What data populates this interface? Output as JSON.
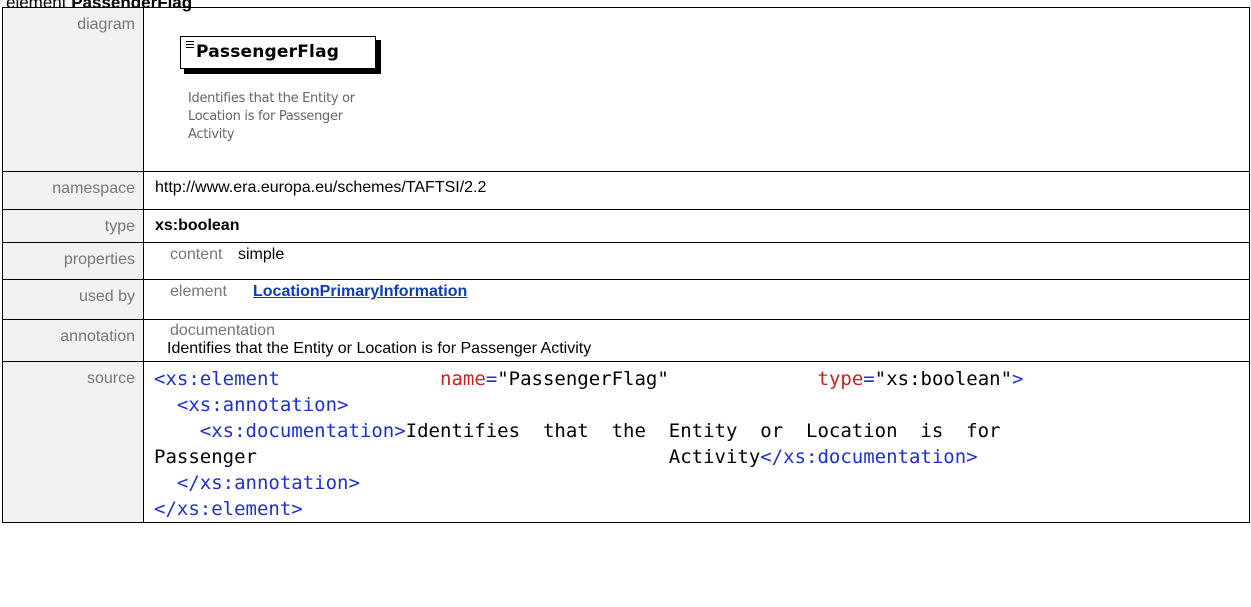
{
  "heading": {
    "prefix": "element ",
    "name": "PassengerFlag"
  },
  "rows": {
    "diagram": {
      "label": "diagram",
      "element_name": "PassengerFlag",
      "doc_lines": [
        "Identifies that the Entity or",
        "Location is for Passenger",
        "Activity"
      ]
    },
    "namespace": {
      "label": "namespace",
      "value": "http://www.era.europa.eu/schemes/TAFTSI/2.2"
    },
    "type": {
      "label": "type",
      "value": "xs:boolean"
    },
    "properties": {
      "label": "properties",
      "key": "content",
      "value": "simple"
    },
    "used_by": {
      "label": "used by",
      "key": "element",
      "link": "LocationPrimaryInformation"
    },
    "annotation": {
      "label": "annotation",
      "key": "documentation",
      "value": "Identifies that the Entity or Location is for Passenger Activity"
    },
    "source": {
      "label": "source",
      "line1_open": "<xs:element",
      "attr1_name": "name",
      "attr1_eq": "=",
      "attr1_value": "\"PassengerFlag\"",
      "attr2_name": "type",
      "attr2_eq": "=",
      "attr2_value": "\"xs:boolean\"",
      "line1_close": ">",
      "line2": "<xs:annotation>",
      "line3_open": "<xs:documentation>",
      "line3_text": "Identifies  that  the  Entity  or  Location  is  for",
      "line4_text_left": "Passenger",
      "line4_text_right": "Activity",
      "line4_close": "</xs:documentation>",
      "line5": "</xs:annotation>",
      "line6": "</xs:element>"
    }
  },
  "colors": {
    "label_bg": "#f2f2f2",
    "link": "#0b3eb6",
    "tag": "#9b1b1b",
    "bracket": "#1c30d6",
    "attr": "#d11f1f"
  }
}
